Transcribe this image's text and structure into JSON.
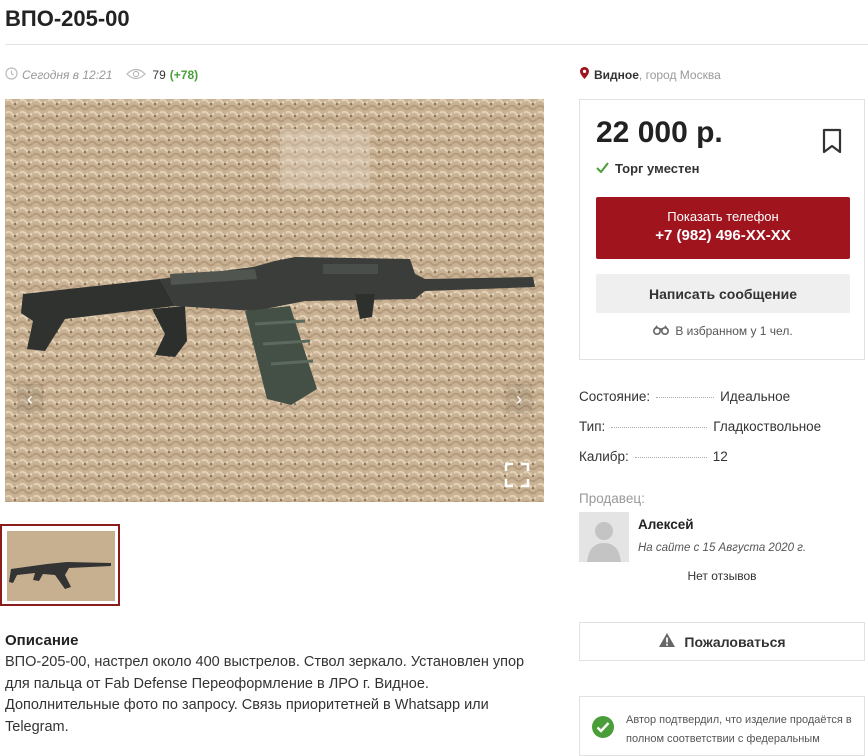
{
  "listing": {
    "title": "ВПО-205-00",
    "posted": "Сегодня в 12:21",
    "views": "79",
    "views_delta": "(+78)"
  },
  "location": {
    "place": "Видное",
    "city": ", город Москва"
  },
  "price": {
    "amount": "22 000 р.",
    "bargain": "Торг уместен",
    "show_phone_label": "Показать телефон",
    "phone": "+7 (982) 496-XX-XX",
    "message_label": "Написать сообщение",
    "favorites": "В избранном у 1 чел."
  },
  "properties": [
    {
      "key": "Состояние:",
      "value": "Идеальное"
    },
    {
      "key": "Тип:",
      "value": "Гладкоствольное"
    },
    {
      "key": "Калибр:",
      "value": "12"
    }
  ],
  "seller": {
    "heading": "Продавец:",
    "name": "Алексей",
    "since": "На сайте с 15 Августа 2020 г.",
    "reviews": "Нет отзывов"
  },
  "complain_label": "Пожаловаться",
  "confirmation": "Автор подтвердил, что изделие продаётся в полном соответствии с федеральным",
  "description": {
    "heading": "Описание",
    "text": "ВПО-205-00, настрел около 400 выстрелов. Ствол зеркало. Установлен упор для пальца от Fab Defense Переоформление в ЛРО г. Видное. Дополнительные фото по запросу. Связь приоритетней в Whatsapp или Telegram."
  },
  "icons": {
    "clock": "clock-icon",
    "eye": "eye-icon",
    "pin": "location-pin-icon",
    "bookmark": "bookmark-icon",
    "check": "check-icon",
    "binoculars": "binoculars-icon",
    "warning": "warning-icon",
    "verified": "verified-check-icon",
    "prev": "chevron-left-icon",
    "next": "chevron-right-icon",
    "fullscreen": "fullscreen-icon"
  },
  "colors": {
    "accent": "#a0141e",
    "success": "#4a9e3a",
    "thumb_border": "#8a1c1c"
  }
}
